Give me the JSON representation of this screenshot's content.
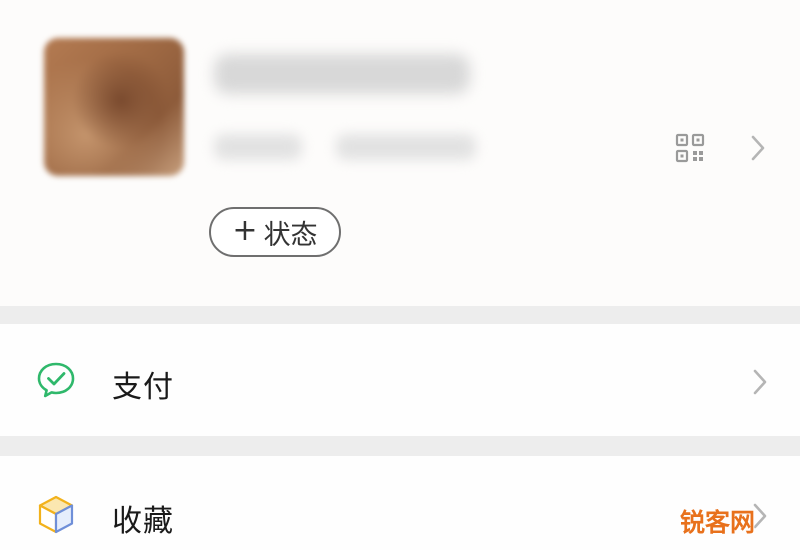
{
  "profile": {
    "status_plus": "+",
    "status_label": "状态"
  },
  "menu": {
    "items": [
      {
        "label": "支付",
        "icon": "wechat-pay-icon",
        "accent": "#2fb86b"
      },
      {
        "label": "收藏",
        "icon": "favorites-cube-icon",
        "accent": "#f2b21c"
      }
    ]
  },
  "watermark": {
    "text": "锐客网",
    "color": "#e8711c"
  },
  "colors": {
    "background": "#fcfcfc",
    "separator": "#ededed",
    "chevron": "#b5b5b5"
  }
}
